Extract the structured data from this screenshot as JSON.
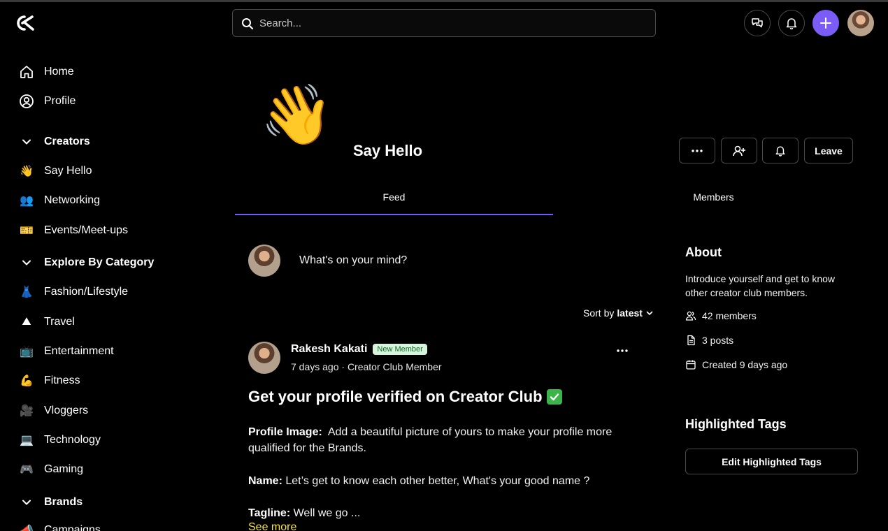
{
  "header": {
    "search_placeholder": "Search...",
    "accent": "#7b5cf6"
  },
  "sidebar": {
    "items": [
      {
        "label": "Home",
        "icon": "home-icon"
      },
      {
        "label": "Profile",
        "icon": "user-circle-icon"
      }
    ],
    "sections": [
      {
        "label": "Creators",
        "items": [
          {
            "label": "Say Hello",
            "icon": "waving-hand-emoji"
          },
          {
            "label": "Networking",
            "icon": "people-emoji"
          },
          {
            "label": "Events/Meet-ups",
            "icon": "ticket-emoji"
          }
        ]
      },
      {
        "label": "Explore By Category",
        "items": [
          {
            "label": "Fashion/Lifestyle",
            "icon": "dress-emoji"
          },
          {
            "label": "Travel",
            "icon": "mountain-emoji"
          },
          {
            "label": "Entertainment",
            "icon": "tv-emoji"
          },
          {
            "label": "Fitness",
            "icon": "flexed-biceps-emoji"
          },
          {
            "label": "Vloggers",
            "icon": "camera-emoji"
          },
          {
            "label": "Technology",
            "icon": "laptop-emoji"
          },
          {
            "label": "Gaming",
            "icon": "game-controller-emoji"
          }
        ]
      },
      {
        "label": "Brands",
        "items": [
          {
            "label": "Campaigns",
            "icon": "megaphone-emoji"
          }
        ]
      }
    ]
  },
  "group": {
    "emoji": "👋",
    "title": "Say Hello",
    "leave_label": "Leave",
    "tabs": [
      "Feed",
      "Members"
    ]
  },
  "composer": {
    "placeholder": "What's on your mind?"
  },
  "sort": {
    "prefix": "Sort by",
    "value": "latest"
  },
  "post": {
    "author": "Rakesh Kakati",
    "badge": "New Member",
    "meta": "7 days ago · Creator Club Member",
    "title": "Get your profile verified on Creator Club",
    "paragraphs": [
      {
        "label": "Profile Image:",
        "text": "Add a beautiful picture of yours to make your profile more qualified for the Brands."
      },
      {
        "label": "Name:",
        "text": "Let’s get to know each other better, What's your good name ?"
      },
      {
        "label": "Tagline:",
        "text": "Well we go ..."
      }
    ],
    "see_more": "See more"
  },
  "about": {
    "title": "About",
    "description": "Introduce yourself and get to know other creator club members.",
    "members": "42 members",
    "posts": "3 posts",
    "created": "Created 9 days ago"
  },
  "tags": {
    "title": "Highlighted Tags",
    "edit_label": "Edit Highlighted Tags"
  }
}
